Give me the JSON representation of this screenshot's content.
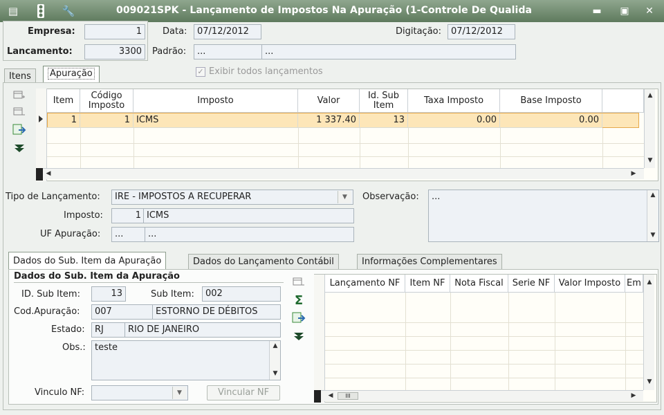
{
  "window": {
    "title": "009021SPK - Lançamento de Impostos Na Apuração (1-Controle De Qualida",
    "minimize": "▬",
    "maximize": "▣",
    "close": "✕"
  },
  "header": {
    "empresa_label": "Empresa:",
    "empresa_value": "1",
    "lancamento_label": "Lancamento:",
    "lancamento_value": "3300",
    "data_label": "Data:",
    "data_value": "07/12/2012",
    "padrao_label": "Padrão:",
    "padrao_code": "...",
    "padrao_desc": "...",
    "digitacao_label": "Digitação:",
    "digitacao_value": "07/12/2012",
    "exibir_label": "Exibir todos lançamentos"
  },
  "tabs": {
    "itens": "Itens",
    "apuracao": "Apuração"
  },
  "grid": {
    "headers": [
      "Item",
      "Código Imposto",
      "Imposto",
      "Valor",
      "Id. Sub Item",
      "Taxa Imposto",
      "Base Imposto"
    ],
    "rows": [
      {
        "item": "1",
        "codigo": "1",
        "imposto": "ICMS",
        "valor": "1 337.40",
        "idsub": "13",
        "taxa": "0.00",
        "base": "0.00"
      }
    ]
  },
  "form": {
    "tipo_label": "Tipo de Lançamento:",
    "tipo_value": "IRE - IMPOSTOS A RECUPERAR",
    "imposto_label": "Imposto:",
    "imposto_code": "1",
    "imposto_desc": "ICMS",
    "uf_label": "UF Apuração:",
    "uf_code": "...",
    "uf_desc": "...",
    "obs_label": "Observação:",
    "obs_value": "..."
  },
  "subtabs": {
    "t1": "Dados do Sub. Item da Apuração",
    "t2": "Dados do Lançamento Contábil",
    "t3": "Informações Complementares"
  },
  "sub": {
    "section_title": "Dados do Sub. Item da Apuração",
    "idsub_label": "ID. Sub Item:",
    "idsub_value": "13",
    "subitem_label": "Sub Item:",
    "subitem_value": "002",
    "cod_label": "Cod.Apuração:",
    "cod_value": "007",
    "cod_desc": "ESTORNO DE DÉBITOS",
    "estado_label": "Estado:",
    "estado_code": "RJ",
    "estado_desc": "RIO DE JANEIRO",
    "obs_label": "Obs.:",
    "obs_value": "teste",
    "vinculo_label": "Vinculo NF:",
    "vincular_button": "Vincular NF"
  },
  "nf_grid": {
    "headers": [
      "Lançamento NF",
      "Item NF",
      "Nota Fiscal",
      "Serie NF",
      "Valor Imposto",
      "Em"
    ],
    "hscroll": "III"
  }
}
